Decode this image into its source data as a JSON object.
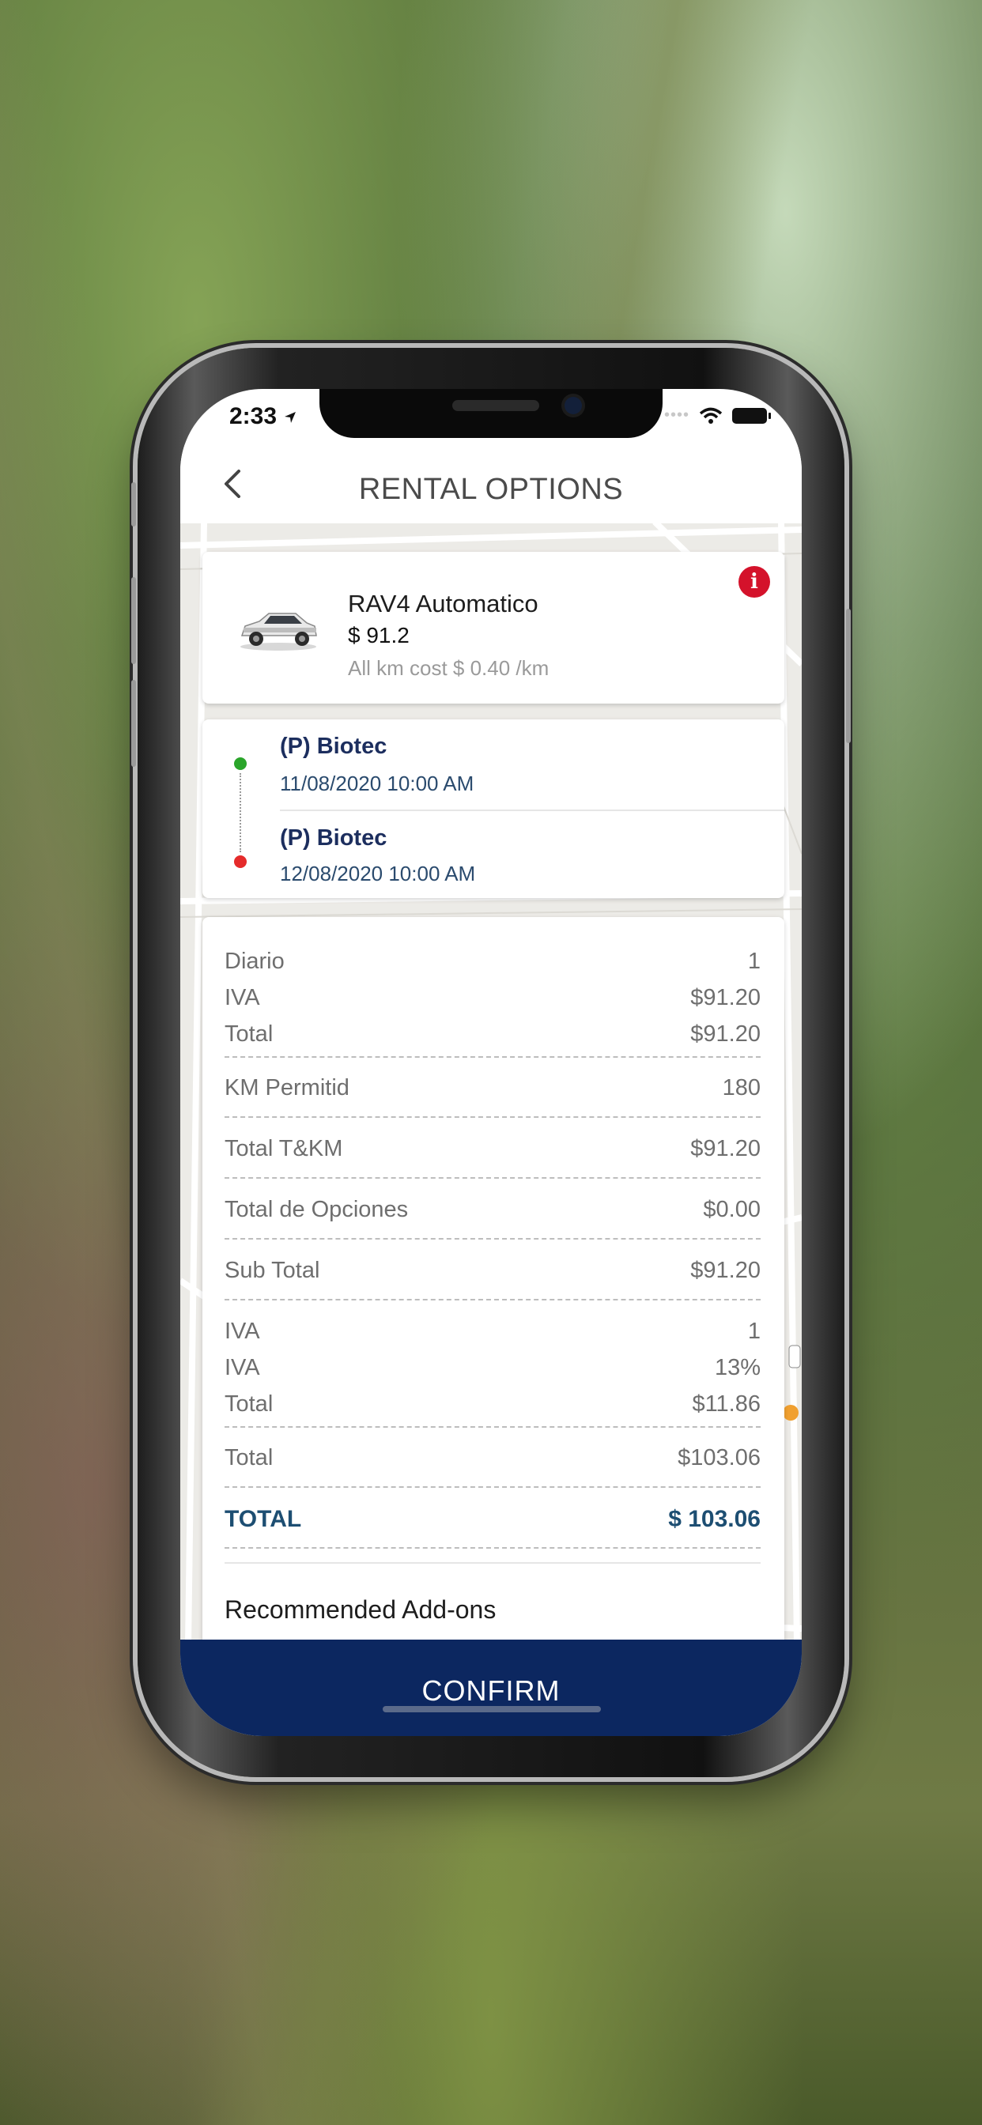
{
  "status": {
    "time": "2:33"
  },
  "nav": {
    "title": "RENTAL OPTIONS"
  },
  "vehicle": {
    "name": "RAV4 Automatico",
    "price": "$ 91.2",
    "km_cost": "All km cost $ 0.40 /km"
  },
  "route": {
    "pickup": {
      "name": "(P) Biotec",
      "date": "11/08/2020 10:00 AM"
    },
    "dropoff": {
      "name": "(P) Biotec",
      "date": "12/08/2020 10:00 AM"
    }
  },
  "summary": {
    "rows": [
      {
        "label": "Diario",
        "value": "1"
      },
      {
        "label": "IVA",
        "value": "$91.20"
      },
      {
        "label": "Total",
        "value": "$91.20"
      },
      {
        "label": "KM Permitid",
        "value": "180"
      },
      {
        "label": "Total T&KM",
        "value": "$91.20"
      },
      {
        "label": "Total de Opciones",
        "value": "$0.00"
      },
      {
        "label": "Sub Total",
        "value": "$91.20"
      },
      {
        "label": "IVA",
        "value": "1"
      },
      {
        "label": "IVA",
        "value": "13%"
      },
      {
        "label": "Total",
        "value": "$11.86"
      },
      {
        "label": "Total",
        "value": "$103.06"
      }
    ],
    "grand_total": {
      "label": "TOTAL",
      "value": "$ 103.06"
    },
    "addons_title": "Recommended Add-ons"
  },
  "actions": {
    "confirm_label": "CONFIRM"
  },
  "colors": {
    "navy": "#0c2760",
    "accent_red": "#d4122b",
    "total_blue": "#1d4e72",
    "pickup_dot": "#2aa52a",
    "dropoff_dot": "#e52b2b"
  }
}
